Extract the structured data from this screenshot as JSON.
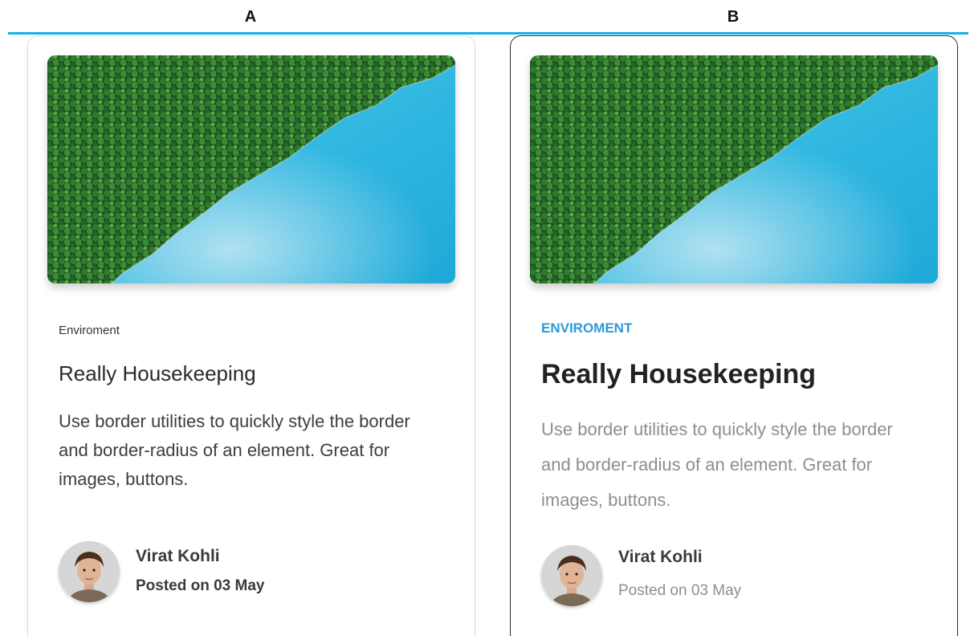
{
  "panels": {
    "a_label": "A",
    "b_label": "B"
  },
  "card_a": {
    "category": "Enviroment",
    "title": "Really Housekeeping",
    "description": "Use border utilities to quickly style the border and border-radius of an element. Great for images, buttons.",
    "author": "Virat Kohli",
    "posted": "Posted on 03 May",
    "image_icon": "forest-lake-photo",
    "avatar_icon": "avatar-photo"
  },
  "card_b": {
    "category": "ENVIROMENT",
    "title": "Really Housekeeping",
    "description": "Use border utilities to quickly style the border and border-radius of an element. Great for images, buttons.",
    "author": "Virat Kohli",
    "posted": "Posted on 03 May",
    "image_icon": "forest-lake-photo",
    "avatar_icon": "avatar-photo"
  },
  "colors": {
    "accent_rule": "#19b0e2",
    "category_b": "#2b9ad8",
    "muted_text": "#8a8f94",
    "water": "#2fb6e0",
    "forest": "#1f5a22"
  }
}
